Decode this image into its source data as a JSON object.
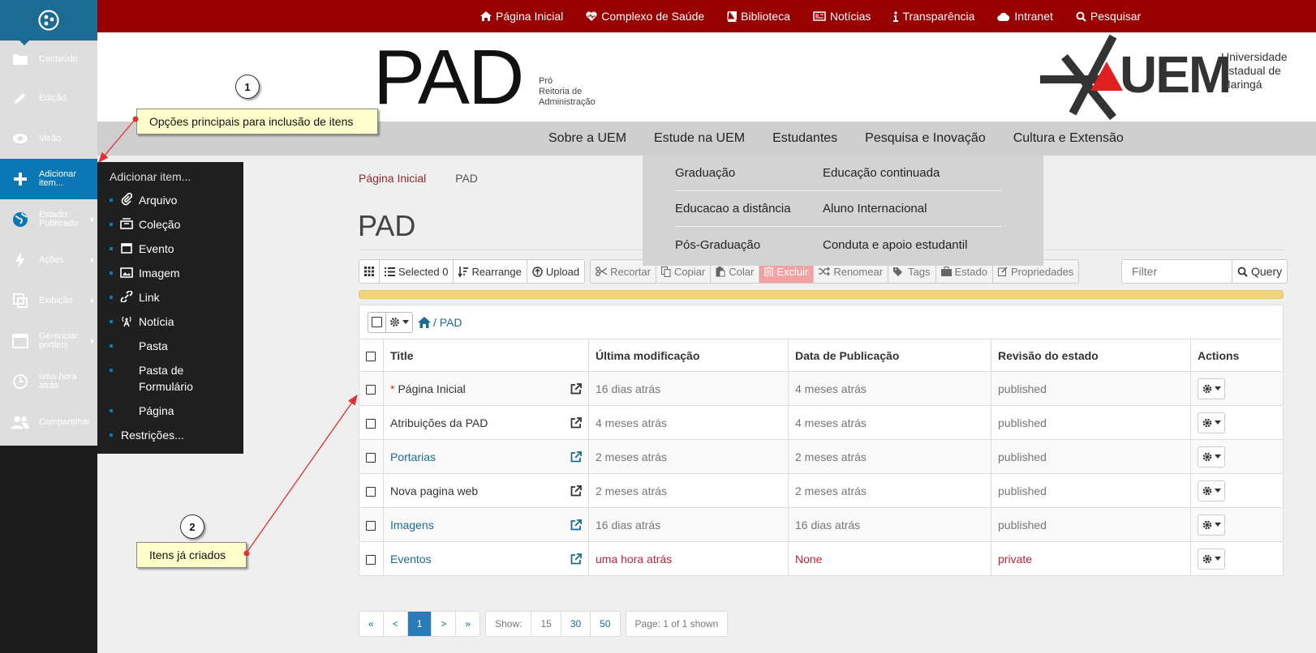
{
  "toolbar": {
    "items": [
      {
        "label": "Conteúdo",
        "icon": "folder-icon"
      },
      {
        "label": "Edição",
        "icon": "pencil-icon"
      },
      {
        "label": "Visão",
        "icon": "eye-icon"
      },
      {
        "label": "Adicionar item...",
        "icon": "plus-icon"
      },
      {
        "label": "Estado: Publicado",
        "icon": "globe-icon"
      },
      {
        "label": "Ações",
        "icon": "bolt-icon"
      },
      {
        "label": "Exibição",
        "icon": "display-icon"
      },
      {
        "label": "Gerenciar portlets",
        "icon": "portlet-icon"
      },
      {
        "label": "uma hora atrás",
        "icon": "clock-icon"
      },
      {
        "label": "Compartilhar",
        "icon": "users-icon"
      }
    ]
  },
  "add_menu": {
    "title": "Adicionar item...",
    "items": [
      "Arquivo",
      "Coleção",
      "Evento",
      "Imagem",
      "Link",
      "Notícia",
      "Pasta",
      "Pasta de Formulário",
      "Página"
    ],
    "restrictions": "Restrições..."
  },
  "topnav": {
    "links": [
      "Página Inicial",
      "Complexo de Saúde",
      "Biblioteca",
      "Notícias",
      "Transparência",
      "Intranet",
      "Pesquisar"
    ]
  },
  "header": {
    "logo_text": "PAD",
    "logo_sub": [
      "Pró",
      "Reitoria de",
      "Administração"
    ],
    "uem_text": "UEM",
    "uem_sub": [
      "Universidade",
      "Estadual de",
      "Maringá"
    ]
  },
  "mainnav": {
    "links": [
      "Sobre a UEM",
      "Estude na UEM",
      "Estudantes",
      "Pesquisa e Inovação",
      "Cultura e Extensão"
    ]
  },
  "estude_dropdown": {
    "rows": [
      [
        "Graduação",
        "Educação continuada"
      ],
      [
        "Educacao a distância",
        "Aluno Internacional"
      ],
      [
        "Pós-Graduação",
        "Conduta e apoio estudantil"
      ]
    ]
  },
  "breadcrumb": {
    "home": "Página Inicial",
    "current": "PAD"
  },
  "page_title": "PAD",
  "fc_toolbar": {
    "selected": "Selected 0",
    "rearrange": "Rearrange",
    "upload": "Upload",
    "cut": "Recortar",
    "copy": "Copiar",
    "paste": "Colar",
    "delete": "Excluir",
    "rename": "Renomear",
    "tags": "Tags",
    "state": "Estado",
    "properties": "Propriedades",
    "filter_placeholder": "Filter",
    "query": "Query"
  },
  "path": {
    "label": "/ PAD"
  },
  "table": {
    "headers": [
      "Title",
      "Última modificação",
      "Data de Publicação",
      "Revisão do estado",
      "Actions"
    ],
    "rows": [
      {
        "title": "Página Inicial",
        "modified": "16 dias atrás",
        "published": "4 meses atrás",
        "state": "published"
      },
      {
        "title": "Atribuições da PAD",
        "modified": "4 meses atrás",
        "published": "4 meses atrás",
        "state": "published"
      },
      {
        "title": "Portarias",
        "modified": "2 meses atrás",
        "published": "2 meses atrás",
        "state": "published"
      },
      {
        "title": "Nova pagina web",
        "modified": "2 meses atrás",
        "published": "2 meses atrás",
        "state": "published"
      },
      {
        "title": "Imagens",
        "modified": "16 dias atrás",
        "published": "16 dias atrás",
        "state": "published"
      },
      {
        "title": "Eventos",
        "modified": "uma hora atrás",
        "published": "None",
        "state": "private"
      }
    ]
  },
  "pagination": {
    "nav": [
      "«",
      "<",
      "1",
      ">",
      "»"
    ],
    "show_label": "Show:",
    "sizes": [
      "15",
      "30",
      "50"
    ],
    "page_info": "Page: 1 of 1 shown"
  },
  "annotations": {
    "callout1": "Opções principais para inclusão de itens",
    "callout2": "Itens já criados",
    "num1": "1",
    "num2": "2"
  },
  "colors": {
    "toolbar_blue": "#0b78b5",
    "top_red": "#990000",
    "warning_yellow": "#f0d57a"
  }
}
